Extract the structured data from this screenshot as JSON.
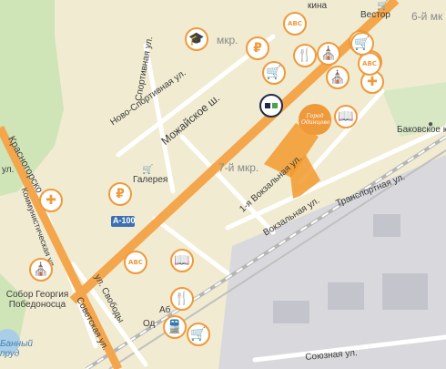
{
  "streets": {
    "mozhaiskoe": "Можайское ш.",
    "novo_sportivnaya": "Ново-Спортивная ул.",
    "sportivnaya": "Спортивная ул.",
    "krasnogorsky": "Красногорско",
    "kommunisticheskaya": "Коммунистическая ул.",
    "svobody": "ул. Свободы",
    "sovetskaya": "Советская ул.",
    "vokzalnaya_1": "1-я Вокзальная ул.",
    "vokzalnaya": "Вокзальная ул.",
    "transportnaya": "Транспортная ул.",
    "soyuznaya": "Союзная ул.",
    "kina": "кина",
    "ul_left": "ул.",
    "fragment_od": "Од",
    "fragment_ab": "Аб"
  },
  "districts": {
    "mkr_top": "мкр.",
    "mkr_6": "6-й мк",
    "mkr_7": "7-й мкр."
  },
  "places": {
    "vestor": "Вестор",
    "galereya": "Галерея",
    "bakovskoe": "Баковское кл",
    "sobor": "Собор Георгия Победоносца",
    "prud": "Банный пруд"
  },
  "road_shield": "А-100",
  "brand_sign": "Город Одинцово",
  "brand_color": "#ef9a3a",
  "pois": [
    {
      "id": "kids-top",
      "icon": "blocks-icon",
      "glyph": "ABC"
    },
    {
      "id": "edu-top",
      "icon": "graduation-cap-icon",
      "glyph": "🎓"
    },
    {
      "id": "bank-top",
      "icon": "money-bag-icon",
      "glyph": "₽"
    },
    {
      "id": "food-top",
      "icon": "food-icon",
      "glyph": "🍴"
    },
    {
      "id": "shop-top",
      "icon": "cart-icon",
      "glyph": "🛒"
    },
    {
      "id": "church-right",
      "icon": "church-icon",
      "glyph": "⛪"
    },
    {
      "id": "bank-right",
      "icon": "money-bag-icon",
      "glyph": "₽"
    },
    {
      "id": "shop-right",
      "icon": "cart-icon",
      "glyph": "🛒"
    },
    {
      "id": "clinic-right",
      "icon": "cross-icon",
      "glyph": "✚"
    },
    {
      "id": "blocks-right",
      "icon": "blocks-icon",
      "glyph": "ABC"
    },
    {
      "id": "church-mid",
      "icon": "church-icon",
      "glyph": "⛪"
    },
    {
      "id": "shop-mid",
      "icon": "cart-icon",
      "glyph": "🛒"
    },
    {
      "id": "book-mid",
      "icon": "book-icon",
      "glyph": "📖"
    },
    {
      "id": "clinic-left",
      "icon": "cross-icon",
      "glyph": "✚"
    },
    {
      "id": "bank-left",
      "icon": "money-bag-icon",
      "glyph": "₽"
    },
    {
      "id": "blocks-bottom",
      "icon": "blocks-icon",
      "glyph": "ABC"
    },
    {
      "id": "book-bottom",
      "icon": "book-icon",
      "glyph": "📖"
    },
    {
      "id": "church-bottom",
      "icon": "church-icon",
      "glyph": "⛪"
    },
    {
      "id": "food-bottom",
      "icon": "food-icon",
      "glyph": "🍴"
    },
    {
      "id": "train-bottom",
      "icon": "train-icon",
      "glyph": "🚆"
    },
    {
      "id": "shop-bottom",
      "icon": "cart-icon",
      "glyph": "🛒"
    }
  ]
}
